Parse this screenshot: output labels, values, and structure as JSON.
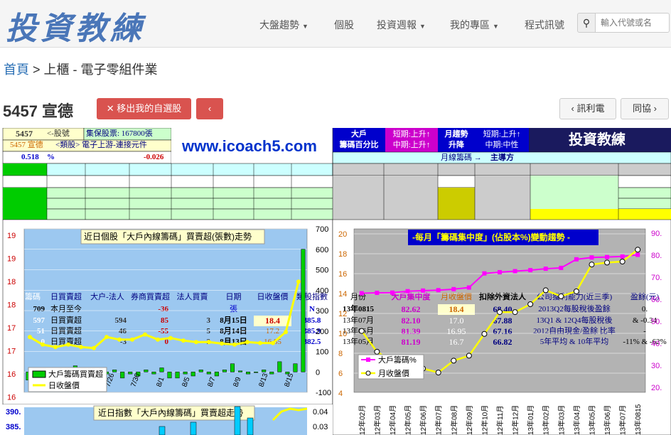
{
  "brand": {
    "logo_text": "投資教練"
  },
  "nav": {
    "items": [
      {
        "label": "大盤趨勢",
        "dropdown": true
      },
      {
        "label": "個股",
        "dropdown": false
      },
      {
        "label": "投資週報",
        "dropdown": true
      },
      {
        "label": "我的專區",
        "dropdown": true
      },
      {
        "label": "程式訊號",
        "dropdown": false
      }
    ],
    "search_placeholder": "輸入代號或名"
  },
  "breadcrumb": {
    "home": "首頁",
    "sep1": " > ",
    "market": "上櫃",
    "sep2": " - ",
    "industry": "電子零組件業"
  },
  "stock": {
    "title": "5457 宣德",
    "remove_label": "移出我的自選股",
    "prev_label": "訊利電",
    "next_label": "同協"
  },
  "panel": {
    "code": "5457",
    "code_note": "<-股號",
    "guarantee": "集保股票: 167800張",
    "name_line": "5457 宣德",
    "category": "<類股> 電子上游-連接元件",
    "pct": "0.518",
    "pct_unit": "%",
    "change": "-0.026",
    "banner": "www.icoach5.com",
    "big": "大戶",
    "big2": "籌碼百分比",
    "short_up": "短期:上升↑",
    "mid_up": "中期:上升↑",
    "trend": "月趨勢",
    "trend2": "升降",
    "short2": "短期:上升↑",
    "mid2": "中期:中性",
    "logo2": "投資教練",
    "monthly_label": "月線籌碼 →",
    "main": "主導方"
  },
  "table_left": {
    "headers": [
      "大戶籌碼",
      "日買賣超",
      "大户-法人",
      "券商買賣超",
      "法人買賣",
      "日期",
      "日收盤價",
      "類股指數"
    ],
    "rows": [
      [
        "709",
        "本月至今",
        "",
        "-36",
        "",
        "張",
        "",
        "N"
      ],
      [
        "597",
        "日買賣超",
        "594",
        "85",
        "3",
        "8月15日",
        "18.4",
        "385.8"
      ],
      [
        "51",
        "日買賣超",
        "46",
        "-55",
        "5",
        "8月14日",
        "17.2",
        "385.9"
      ],
      [
        "0",
        "日買賣超",
        "-3",
        "0",
        "3",
        "8月13日",
        "16.85",
        "382.5"
      ]
    ]
  },
  "table_right": {
    "headers": [
      "月份",
      "大戶集中度",
      "月收盤價",
      "扣除外資法人",
      "公司獲利能力(近三季)",
      "盈餘(元)"
    ],
    "rows": [
      [
        "13年0815",
        "82.62",
        "18.4",
        "68.40",
        "2013Q2每股稅後盈餘",
        "0."
      ],
      [
        "13年07月",
        "82.10",
        "17.0",
        "67.88",
        "13Q1 & 12Q4每股稅後",
        "& -0.34"
      ],
      [
        "13年06月",
        "81.39",
        "16.95",
        "67.16",
        "2012自由現金/盈餘 比率",
        "-"
      ],
      [
        "13年05月",
        "81.19",
        "16.7",
        "66.82",
        "5年平均  &  10年平均",
        "-11% & -62%"
      ]
    ]
  },
  "chart_data": [
    {
      "type": "bar",
      "title": "近日個股「大戶內線籌碼」買賣超(張數)走勢",
      "left_ticks": [
        "19",
        "19",
        "18",
        "18",
        "17",
        "17",
        "16",
        "16"
      ],
      "right_ticks": [
        "700",
        "600",
        "500",
        "400",
        "300",
        "200",
        "100",
        "0",
        "-100"
      ],
      "x_labels": [
        "7/26",
        "7/30",
        "8/1",
        "8/5",
        "8/7",
        "8/9",
        "8/13",
        "8/15"
      ],
      "series": [
        {
          "name": "大戶籌碼買賣超",
          "values": [
            -40,
            -30,
            -10,
            0,
            20,
            -10,
            30,
            -20,
            -10,
            0,
            -10,
            10,
            -30,
            -10,
            -20,
            10,
            -10,
            20,
            -30,
            -30,
            -10,
            -20,
            10,
            -10,
            -20,
            10,
            40,
            5,
            -10,
            0,
            10,
            -10,
            50,
            -10,
            40,
            600
          ]
        },
        {
          "name": "日收盤價",
          "values": [
            17.1,
            16.95,
            16.9,
            16.95,
            16.9,
            16.88,
            17.1,
            17.05,
            17.05,
            17.15,
            17.05,
            17.08,
            17.03,
            17.0,
            17.0,
            16.97,
            16.95,
            17.0,
            16.98,
            16.98,
            17.2,
            18.2
          ]
        }
      ]
    },
    {
      "type": "line",
      "title": "-每月「籌碼集中度」(佔股本%)變動趨勢 -",
      "left_ticks": [
        "20",
        "18",
        "16",
        "14",
        "12",
        "10",
        "8",
        "6",
        "4"
      ],
      "right_ticks": [
        "90.",
        "80.",
        "70.",
        "60.",
        "50.",
        "40.",
        "30.",
        "20."
      ],
      "x": [
        "12年02月",
        "12年03月",
        "12年04月",
        "12年05月",
        "12年06月",
        "12年07月",
        "12年08月",
        "12年09月",
        "12年10月",
        "12年11月",
        "12年12月",
        "13年01月",
        "13年02月",
        "13年03月",
        "13年04月",
        "13年05月",
        "13年06月",
        "13年07月",
        "13年0815"
      ],
      "series": [
        {
          "name": "大戶籌碼%",
          "values": [
            63.5,
            63.7,
            63.8,
            64.5,
            64.8,
            65.0,
            65.5,
            66.3,
            73.2,
            73.8,
            74.3,
            74.8,
            75.5,
            75.9,
            80.1,
            81.0,
            81.2,
            81.5,
            82.3
          ]
        },
        {
          "name": "月收盤價",
          "values": [
            10.2,
            8.1,
            7.1,
            6.9,
            6.4,
            6.0,
            7.2,
            7.7,
            9.9,
            12.1,
            12.1,
            12.9,
            14.3,
            13.7,
            14.2,
            16.9,
            17.1,
            17.2,
            18.4
          ]
        }
      ]
    },
    {
      "type": "bar",
      "title": "近日指數「大戶內線籌碼」買賣超走勢",
      "left_ticks": [
        "390.",
        "385."
      ],
      "right_ticks": [
        "0.04",
        "0.03"
      ]
    }
  ],
  "colors": {
    "accent": "#d9534f",
    "bar_green": "#00cc00",
    "line_yellow": "#ffff00",
    "pink": "#ff00ff",
    "panel_bg": "#9cc8f0",
    "gray_bg": "#b3b3b3"
  }
}
